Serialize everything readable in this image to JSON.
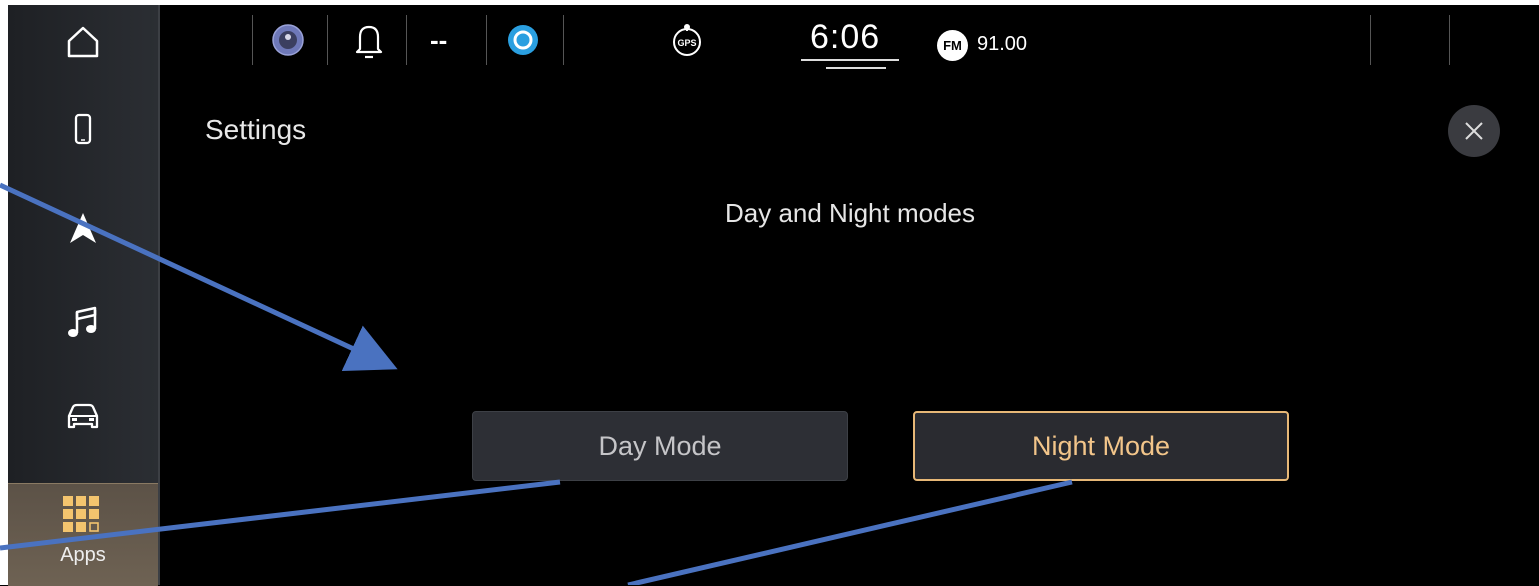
{
  "status_bar": {
    "status_placeholder": "--",
    "clock": "6:06",
    "radio_band": "FM",
    "radio_frequency": "91.00",
    "gps_label": "GPS"
  },
  "nav_rail": {
    "apps_label": "Apps"
  },
  "settings": {
    "title": "Settings",
    "section_title": "Day and Night modes",
    "day_mode_label": "Day Mode",
    "night_mode_label": "Night Mode",
    "selected_mode": "Night Mode"
  },
  "colors": {
    "accent_selected": "#e7b877",
    "annotation_arrow": "#4a72c0",
    "assistant_icon": "#2a9fe0"
  },
  "icons": [
    "home-icon",
    "phone-icon",
    "navigation-icon",
    "music-icon",
    "vehicle-icon",
    "apps-grid-icon",
    "driver-profile-icon",
    "bell-icon",
    "assistant-icon",
    "gps-icon",
    "close-icon"
  ]
}
